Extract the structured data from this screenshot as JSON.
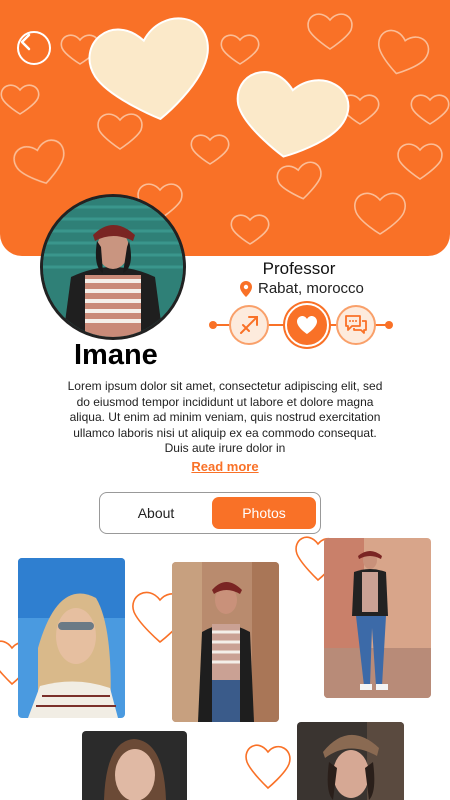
{
  "colors": {
    "accent": "#F97127",
    "accent_soft": "#FDEBDD",
    "heart_fill": "#FBE9C9"
  },
  "header": {
    "back_icon": "chevron-left-icon"
  },
  "profile": {
    "name": "Imane",
    "profession": "Professor",
    "location": "Rabat, morocco",
    "bio": "Lorem ipsum dolor sit amet, consectetur adipiscing elit, sed do eiusmod tempor incididunt ut labore et dolore magna aliqua. Ut enim ad minim veniam, quis nostrud exercitation ullamco laboris nisi ut aliquip ex ea commodo consequat. Duis aute irure dolor in",
    "read_more": "Read more"
  },
  "actions": [
    {
      "name": "sagittarius-icon"
    },
    {
      "name": "heart-icon"
    },
    {
      "name": "chat-icon"
    }
  ],
  "tabs": {
    "about": "About",
    "photos": "Photos",
    "selected": "Photos"
  }
}
